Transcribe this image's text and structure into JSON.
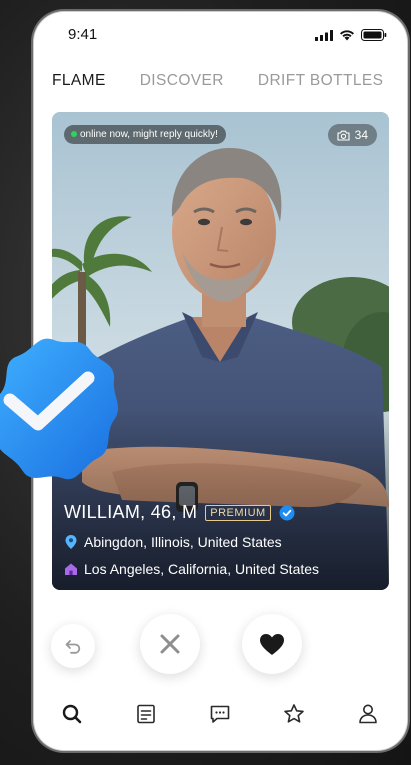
{
  "status": {
    "time": "9:41"
  },
  "tabs": [
    {
      "label": "FLAME",
      "active": true
    },
    {
      "label": "DISCOVER",
      "active": false
    },
    {
      "label": "DRIFT BOTTLES",
      "active": false
    }
  ],
  "profile": {
    "online_text": "online now, might reply quickly!",
    "photo_count": "34",
    "name": "WILLIAM, 46, M",
    "badge": "PREMIUM",
    "location": "Abingdon, Illinois, United States",
    "hometown": "Los Angeles, California, United States"
  },
  "colors": {
    "verified": "#1e8cf0",
    "online": "#2fd35a",
    "premium": "#e8c98a"
  },
  "icons": {
    "undo": "undo-icon",
    "dislike": "close-icon",
    "like": "heart-icon",
    "nav": [
      "search-icon",
      "list-icon",
      "chat-icon",
      "star-icon",
      "profile-icon"
    ]
  }
}
